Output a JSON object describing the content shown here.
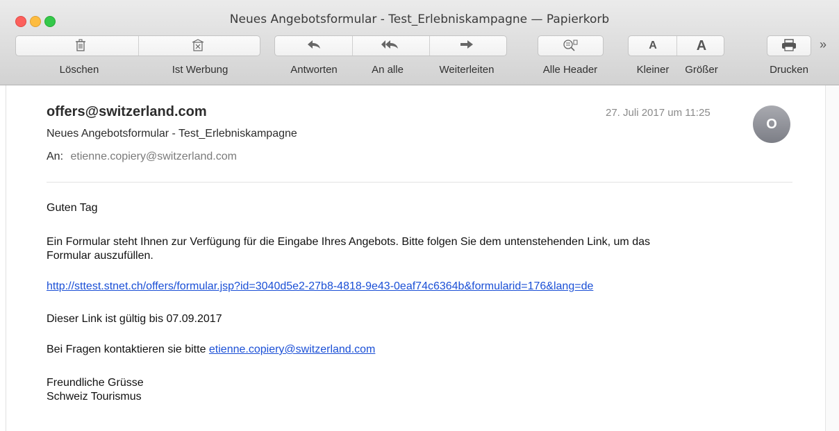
{
  "window": {
    "title": "Neues Angebotsformular - Test_Erlebniskampagne — Papierkorb"
  },
  "toolbar": {
    "delete_label": "Löschen",
    "spam_label": "Ist Werbung",
    "reply_label": "Antworten",
    "reply_all_label": "An alle",
    "forward_label": "Weiterleiten",
    "all_headers_label": "Alle Header",
    "smaller_label": "Kleiner",
    "bigger_label": "Größer",
    "print_label": "Drucken",
    "font_smaller_glyph": "A",
    "font_bigger_glyph": "A",
    "overflow_glyph": "»"
  },
  "message": {
    "sender": "offers@switzerland.com",
    "subject": "Neues Angebotsformular - Test_Erlebniskampagne",
    "to_label": "An:",
    "to_address": "etienne.copiery@switzerland.com",
    "date": "27. Juli 2017 um 11:25",
    "avatar_initial": "O"
  },
  "body": {
    "greeting": "Guten Tag",
    "paragraph1_line1": "Ein Formular steht Ihnen zur Verfügung für die Eingabe Ihres Angebots. Bitte folgen Sie dem untenstehenden Link, um das",
    "paragraph1_line2": "Formular auszufüllen.",
    "form_link": "http://sttest.stnet.ch/offers/formular.jsp?id=3040d5e2-27b8-4818-9e43-0eaf74c6364b&formularid=176&lang=de",
    "validity": "Dieser Link ist gültig bis 07.09.2017",
    "questions_prefix": "Bei Fragen kontaktieren sie bitte ",
    "questions_email": "etienne.copiery@switzerland.com",
    "closing_line1": "Freundliche Grüsse",
    "closing_line2": "Schweiz Tourismus"
  },
  "icons": {
    "delete": "trash-icon",
    "spam": "junk-icon",
    "reply": "reply-icon",
    "reply_all": "reply-all-icon",
    "forward": "forward-icon",
    "headers": "headers-icon",
    "print": "print-icon"
  },
  "colors": {
    "link": "#1a4fd6",
    "close_light": "#fc605c",
    "minimize_light": "#fdbc40",
    "maximize_light": "#34c84a",
    "avatar": "#8e9097"
  }
}
